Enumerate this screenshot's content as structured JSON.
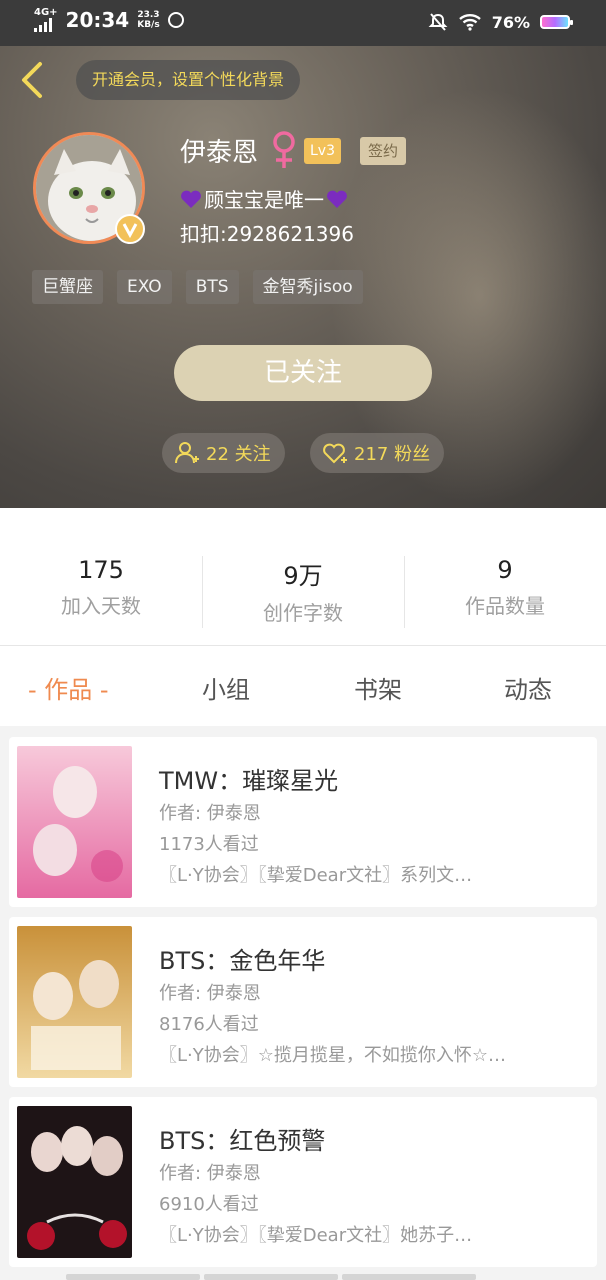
{
  "status_bar": {
    "network": "4G+",
    "time": "20:34",
    "speed_value": "23.3",
    "speed_unit": "KB/s",
    "battery_percent": "76%"
  },
  "header": {
    "vip_prompt": "开通会员，设置个性化背景",
    "username": "伊泰恩",
    "level": "Lv3",
    "signed_badge": "签约",
    "bio": "顾宝宝是唯一",
    "qq": "扣扣:2928621396",
    "tags": [
      "巨蟹座",
      "EXO",
      "BTS",
      "金智秀jisoo"
    ],
    "follow_button": "已关注",
    "following_label": "22 关注",
    "fans_label": "217 粉丝",
    "heart_color": "#7b2cbf",
    "gender_color": "#f06aa0",
    "accent_color": "#f3d95a"
  },
  "stats": [
    {
      "value": "175",
      "label": "加入天数"
    },
    {
      "value": "9万",
      "label": "创作字数"
    },
    {
      "value": "9",
      "label": "作品数量"
    }
  ],
  "tabs": [
    {
      "label": "- 作品 -",
      "active": true
    },
    {
      "label": "小组",
      "active": false
    },
    {
      "label": "书架",
      "active": false
    },
    {
      "label": "动态",
      "active": false
    }
  ],
  "books": [
    {
      "title": "TMW：璀璨星光",
      "author": "作者: 伊泰恩",
      "views": "1173人看过",
      "desc": "〖L·Y协会〗〖挚爱Dear文社〗系列文…"
    },
    {
      "title": "BTS：金色年华",
      "author": "作者: 伊泰恩",
      "views": "8176人看过",
      "desc": "〖L·Y协会〗☆揽月揽星，不如揽你入怀☆…"
    },
    {
      "title": "BTS：红色预警",
      "author": "作者: 伊泰恩",
      "views": "6910人看过",
      "desc": "〖L·Y协会〗〖挚爱Dear文社〗她苏子…"
    }
  ]
}
